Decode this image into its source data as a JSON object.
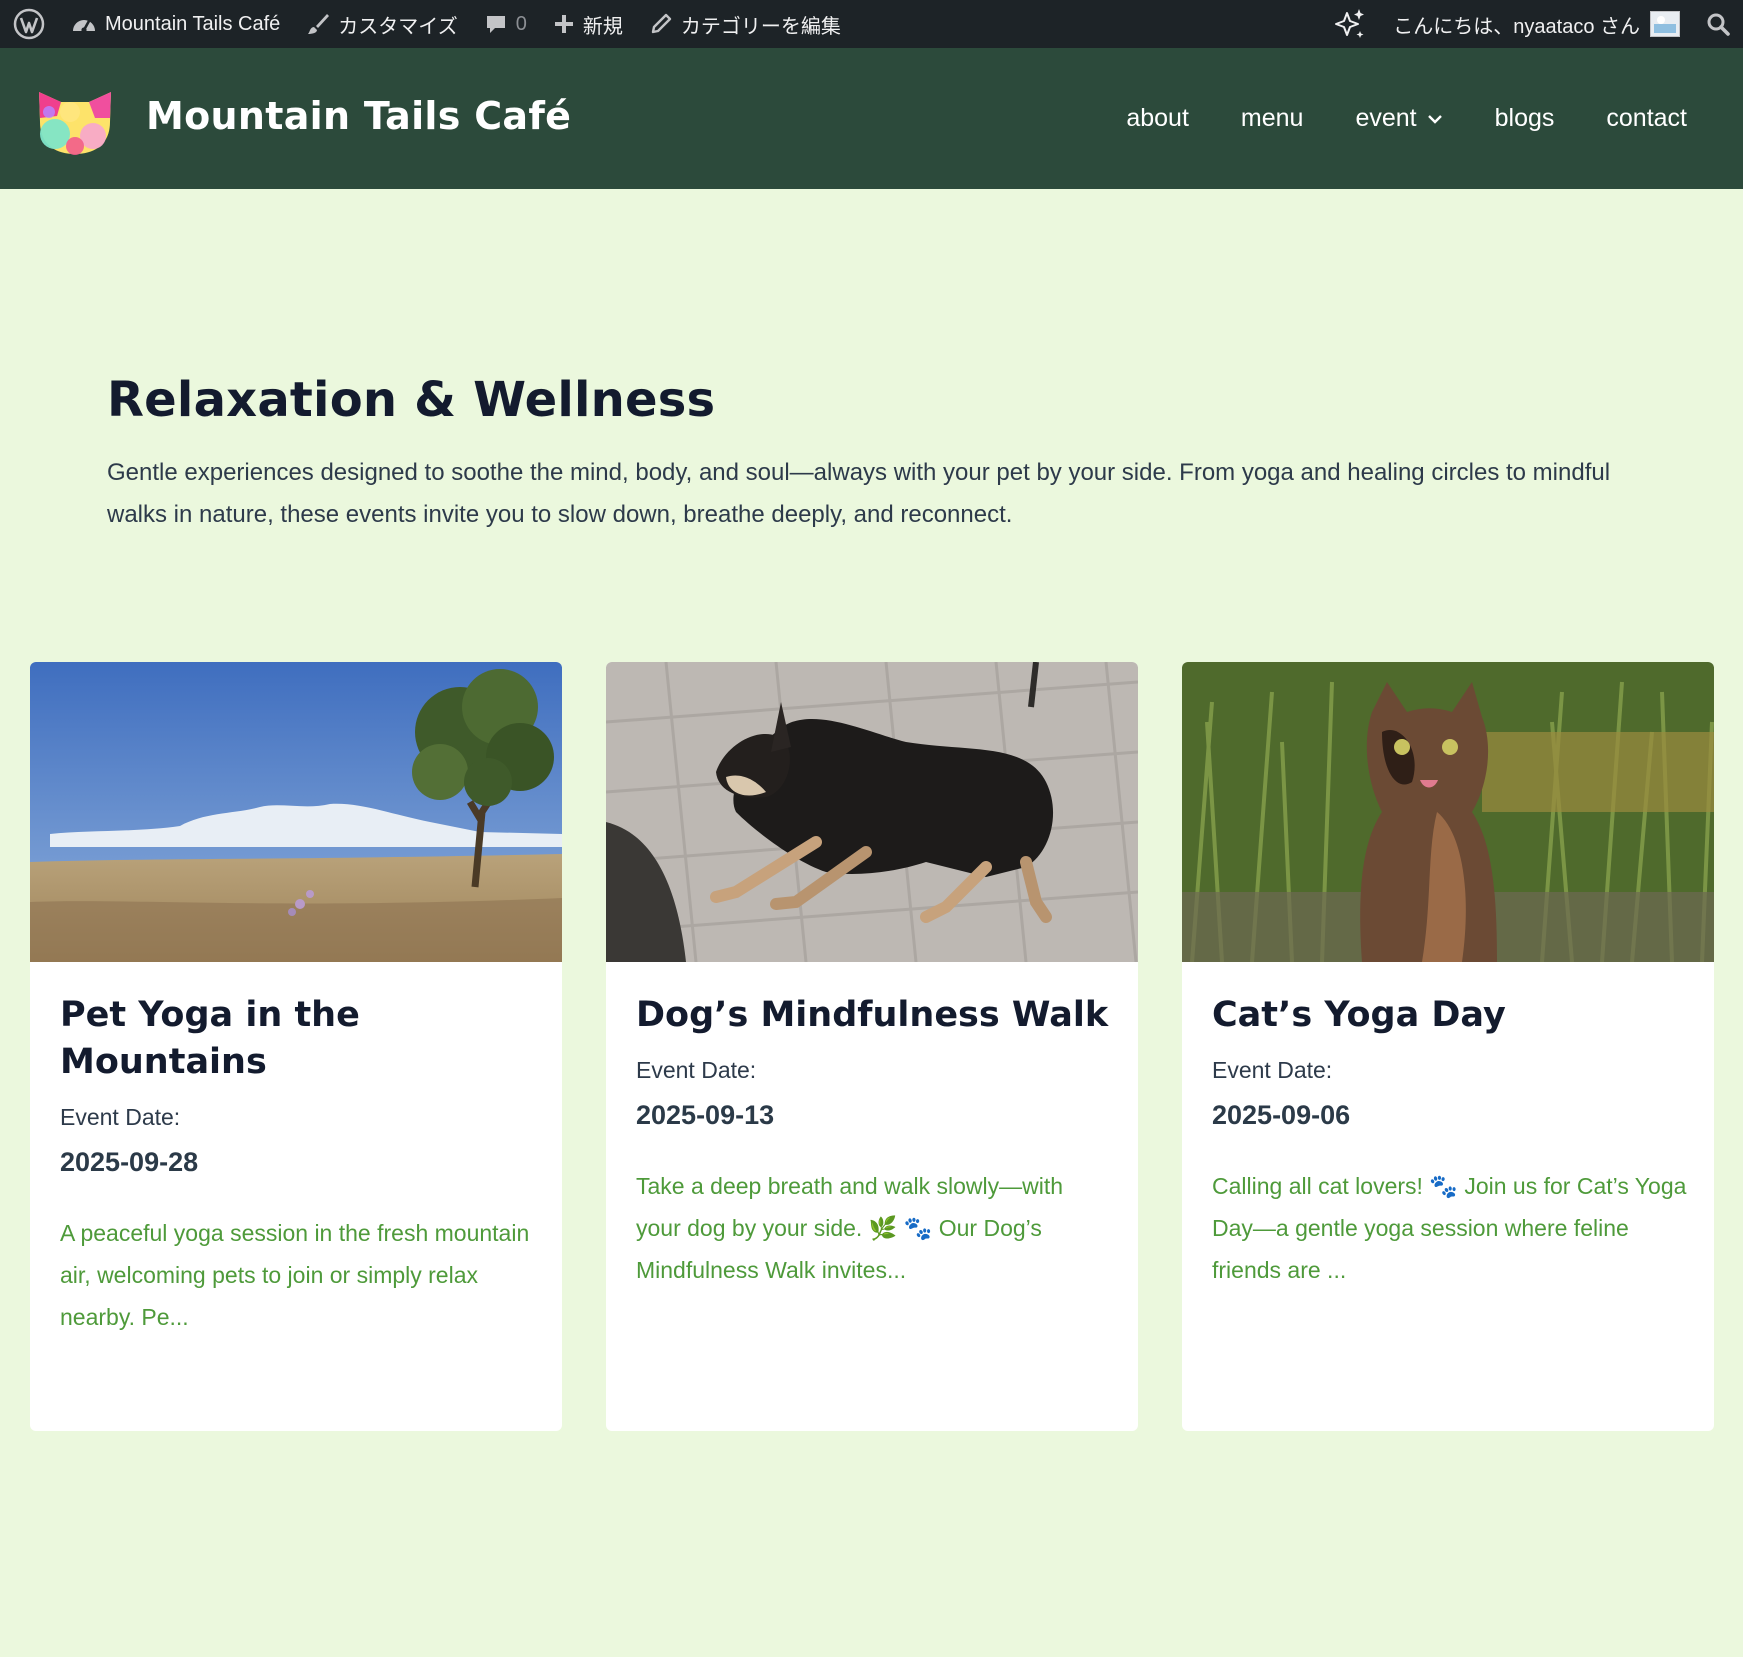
{
  "admin_bar": {
    "site_name": "Mountain Tails Café",
    "customize": "カスタマイズ",
    "comments_count": "0",
    "new": "新規",
    "edit_category": "カテゴリーを編集",
    "greeting": "こんにちは、nyaataco さん"
  },
  "header": {
    "site_title": "Mountain Tails Café",
    "nav": [
      "about",
      "menu",
      "event",
      "blogs",
      "contact"
    ]
  },
  "archive": {
    "title": "Relaxation & Wellness",
    "description": "Gentle experiences designed to soothe the mind, body, and soul—always with your pet by your side. From yoga and healing circles to mindful walks in nature, these events invite you to slow down, breathe deeply, and reconnect."
  },
  "cards": [
    {
      "title": "Pet Yoga in the Mountains",
      "date_label": "Event Date:",
      "date": "2025-09-28",
      "excerpt": "A peaceful yoga session in the fresh mountain air, welcoming pets to join or simply relax nearby. Pe..."
    },
    {
      "title": "Dog’s Mindfulness Walk",
      "date_label": "Event Date:",
      "date": "2025-09-13",
      "excerpt": "Take a deep breath and walk slowly—with your dog by your side. 🌿 🐾 Our Dog’s Mindfulness Walk invites..."
    },
    {
      "title": "Cat’s Yoga Day",
      "date_label": "Event Date:",
      "date": "2025-09-06",
      "excerpt": "Calling all cat lovers! 🐾 Join us for Cat’s Yoga Day—a gentle yoga session where feline friends are ..."
    }
  ],
  "colors": {
    "page_bg": "#ebf8dd",
    "header_bg": "#2c4a3b",
    "admin_bar_bg": "#1d2327",
    "excerpt_text": "#4e9a3a",
    "title_text": "#131b2e"
  },
  "icons": {
    "admin_bar": [
      "wordpress-icon",
      "dashboard-icon",
      "brush-icon",
      "comment-icon",
      "plus-icon",
      "pencil-icon",
      "sparkle-icon",
      "avatar-image",
      "search-icon"
    ],
    "nav": [
      "chevron-down-icon"
    ]
  }
}
